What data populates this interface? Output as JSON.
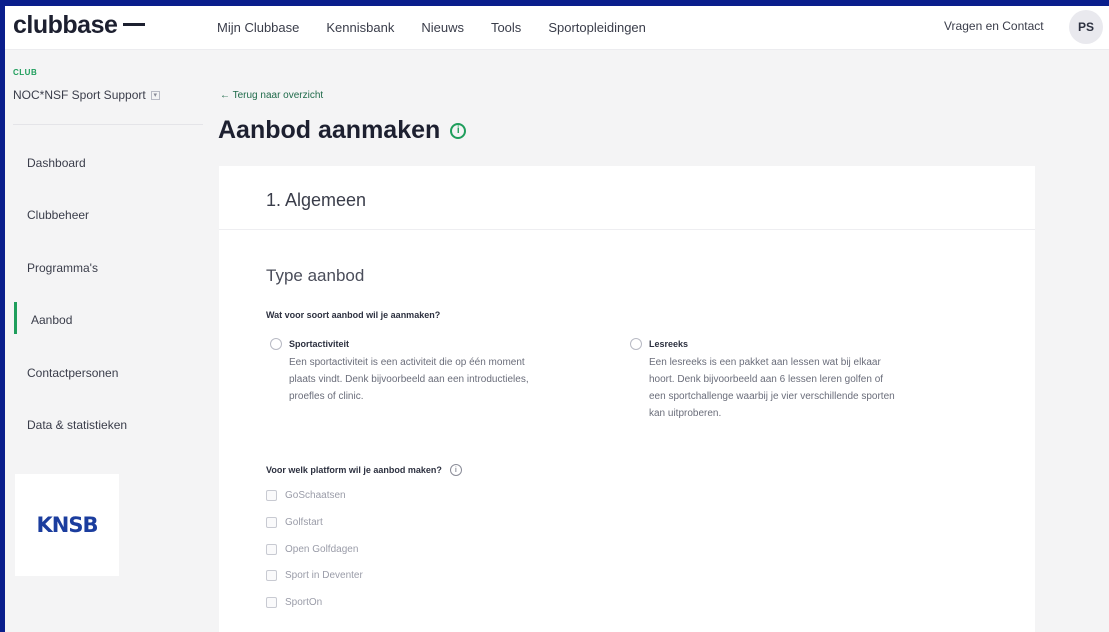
{
  "header": {
    "logo": "clubbase",
    "nav": [
      "Mijn Clubbase",
      "Kennisbank",
      "Nieuws",
      "Tools",
      "Sportopleidingen"
    ],
    "contact": "Vragen en Contact",
    "avatar_initials": "PS"
  },
  "sidebar": {
    "club_caption": "CLUB",
    "club_name": "NOC*NSF Sport Support",
    "items": [
      {
        "label": "Dashboard"
      },
      {
        "label": "Clubbeheer"
      },
      {
        "label": "Programma's"
      },
      {
        "label": "Aanbod",
        "active": true
      },
      {
        "label": "Contactpersonen"
      },
      {
        "label": "Data & statistieken"
      }
    ],
    "org_logo_text": "KNSB"
  },
  "main": {
    "back_link": "← Terug naar overzicht",
    "title": "Aanbod aanmaken",
    "card": {
      "step_title": "1. Algemeen",
      "section_title": "Type aanbod",
      "question_type": "Wat voor soort aanbod wil je aanmaken?",
      "type_options": [
        {
          "label": "Sportactiviteit",
          "desc": [
            "Een sportactiviteit is een activiteit die op één moment",
            "plaats vindt. Denk bijvoorbeeld aan een introductieles,",
            "proefles of clinic."
          ]
        },
        {
          "label": "Lesreeks",
          "desc": [
            "Een lesreeks is een pakket aan lessen wat bij elkaar",
            "hoort. Denk bijvoorbeeld aan 6 lessen leren golfen of",
            "een sportchallenge waarbij je vier verschillende sporten",
            "kan uitproberen."
          ]
        }
      ],
      "question_platform": "Voor welk platform wil je aanbod maken?",
      "platforms": [
        "GoSchaatsen",
        "Golfstart",
        "Open Golfdagen",
        "Sport in Deventer",
        "SportOn"
      ]
    }
  },
  "colors": {
    "frame": "#0a1e8c",
    "accent": "#1f9e5c",
    "background": "#f4f4f5"
  }
}
